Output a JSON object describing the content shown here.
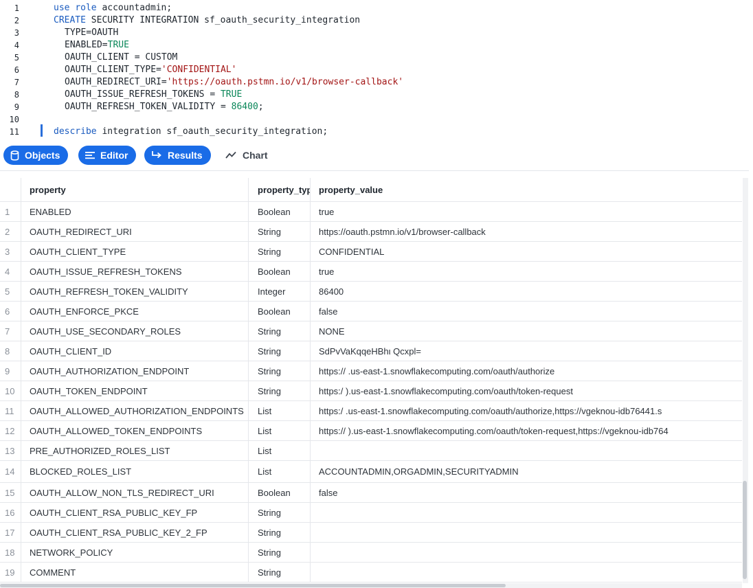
{
  "editor": {
    "lines": [
      {
        "n": "1",
        "segs": [
          {
            "t": "use ",
            "c": "kw"
          },
          {
            "t": "role ",
            "c": "kw"
          },
          {
            "t": "accountadmin;",
            "c": ""
          }
        ]
      },
      {
        "n": "2",
        "segs": [
          {
            "t": "CREATE ",
            "c": "kw"
          },
          {
            "t": "SECURITY INTEGRATION sf_oauth_security_integration",
            "c": ""
          }
        ]
      },
      {
        "n": "3",
        "segs": [
          {
            "t": "TYPE=OAUTH",
            "c": ""
          }
        ]
      },
      {
        "n": "4",
        "segs": [
          {
            "t": "ENABLED=",
            "c": ""
          },
          {
            "t": "TRUE",
            "c": "num"
          }
        ]
      },
      {
        "n": "5",
        "segs": [
          {
            "t": "OAUTH_CLIENT = CUSTOM",
            "c": ""
          }
        ]
      },
      {
        "n": "6",
        "segs": [
          {
            "t": "OAUTH_CLIENT_TYPE=",
            "c": ""
          },
          {
            "t": "'CONFIDENTIAL'",
            "c": "str"
          }
        ]
      },
      {
        "n": "7",
        "segs": [
          {
            "t": "OAUTH_REDIRECT_URI=",
            "c": ""
          },
          {
            "t": "'https://oauth.pstmn.io/v1/browser-callback'",
            "c": "str"
          }
        ]
      },
      {
        "n": "8",
        "segs": [
          {
            "t": "OAUTH_ISSUE_REFRESH_TOKENS = ",
            "c": ""
          },
          {
            "t": "TRUE",
            "c": "num"
          }
        ]
      },
      {
        "n": "9",
        "segs": [
          {
            "t": "OAUTH_REFRESH_TOKEN_VALIDITY = ",
            "c": ""
          },
          {
            "t": "86400",
            "c": "num"
          },
          {
            "t": ";",
            "c": ""
          }
        ]
      },
      {
        "n": "10",
        "segs": []
      },
      {
        "n": "11",
        "segs": [
          {
            "t": "describe ",
            "c": "kw"
          },
          {
            "t": "integration sf_oauth_security_integration;",
            "c": ""
          }
        ]
      }
    ]
  },
  "toolbar": {
    "objects_label": "Objects",
    "editor_label": "Editor",
    "results_label": "Results",
    "chart_label": "Chart"
  },
  "grid": {
    "columns": [
      "property",
      "property_type",
      "property_value"
    ],
    "header_type_display": "property_typ",
    "rows": [
      [
        "1",
        "ENABLED",
        "Boolean",
        "true"
      ],
      [
        "2",
        "OAUTH_REDIRECT_URI",
        "String",
        "https://oauth.pstmn.io/v1/browser-callback"
      ],
      [
        "3",
        "OAUTH_CLIENT_TYPE",
        "String",
        "CONFIDENTIAL"
      ],
      [
        "4",
        "OAUTH_ISSUE_REFRESH_TOKENS",
        "Boolean",
        "true"
      ],
      [
        "5",
        "OAUTH_REFRESH_TOKEN_VALIDITY",
        "Integer",
        "86400"
      ],
      [
        "6",
        "OAUTH_ENFORCE_PKCE",
        "Boolean",
        "false"
      ],
      [
        "7",
        "OAUTH_USE_SECONDARY_ROLES",
        "String",
        "NONE"
      ],
      [
        "8",
        "OAUTH_CLIENT_ID",
        "String",
        "SdPvVaKqqeHBhι                 Qcxpl="
      ],
      [
        "9",
        "OAUTH_AUTHORIZATION_ENDPOINT",
        "String",
        "https://                    .us-east-1.snowflakecomputing.com/oauth/authorize"
      ],
      [
        "10",
        "OAUTH_TOKEN_ENDPOINT",
        "String",
        "https:/                     ).us-east-1.snowflakecomputing.com/oauth/token-request"
      ],
      [
        "11",
        "OAUTH_ALLOWED_AUTHORIZATION_ENDPOINTS",
        "List",
        "https:/                     .us-east-1.snowflakecomputing.com/oauth/authorize,https://vgeknou-idb76441.s"
      ],
      [
        "12",
        "OAUTH_ALLOWED_TOKEN_ENDPOINTS",
        "List",
        "https://                    ).us-east-1.snowflakecomputing.com/oauth/token-request,https://vgeknou-idb764"
      ],
      [
        "13",
        "PRE_AUTHORIZED_ROLES_LIST",
        "List",
        ""
      ],
      [
        "14",
        "BLOCKED_ROLES_LIST",
        "List",
        "ACCOUNTADMIN,ORGADMIN,SECURITYADMIN"
      ],
      [
        "15",
        "OAUTH_ALLOW_NON_TLS_REDIRECT_URI",
        "Boolean",
        "false"
      ],
      [
        "16",
        "OAUTH_CLIENT_RSA_PUBLIC_KEY_FP",
        "String",
        ""
      ],
      [
        "17",
        "OAUTH_CLIENT_RSA_PUBLIC_KEY_2_FP",
        "String",
        ""
      ],
      [
        "18",
        "NETWORK_POLICY",
        "String",
        ""
      ],
      [
        "19",
        "COMMENT",
        "String",
        ""
      ]
    ]
  },
  "colors": {
    "accent": "#1a6ce7",
    "keyword": "#1a5bbf",
    "string": "#a31515",
    "number": "#098658"
  },
  "icons": {
    "objects": "database-icon",
    "editor": "lines-icon",
    "results": "arrow-return-icon",
    "chart": "line-chart-icon"
  }
}
